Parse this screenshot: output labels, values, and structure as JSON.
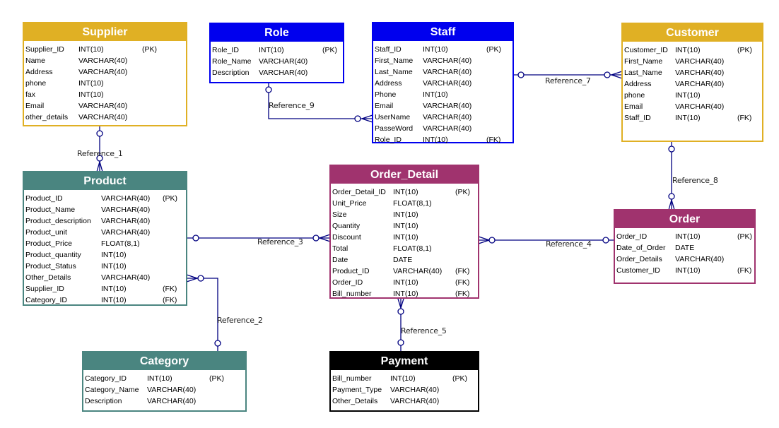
{
  "colors": {
    "gold": "#E0B024",
    "blue": "#0000EE",
    "teal": "#4A8580",
    "purple": "#A0336E",
    "black": "#000000",
    "line": "#000080"
  },
  "entities": {
    "supplier": {
      "title": "Supplier",
      "fields": [
        [
          "Supplier_ID",
          "INT(10)",
          "(PK)"
        ],
        [
          "Name",
          "VARCHAR(40)",
          ""
        ],
        [
          "Address",
          "VARCHAR(40)",
          ""
        ],
        [
          "phone",
          "INT(10)",
          ""
        ],
        [
          "fax",
          "INT(10)",
          ""
        ],
        [
          "Email",
          "VARCHAR(40)",
          ""
        ],
        [
          "other_details",
          "VARCHAR(40)",
          ""
        ]
      ]
    },
    "role": {
      "title": "Role",
      "fields": [
        [
          "Role_ID",
          "INT(10)",
          "(PK)"
        ],
        [
          "Role_Name",
          "VARCHAR(40)",
          ""
        ],
        [
          "Description",
          "VARCHAR(40)",
          ""
        ]
      ]
    },
    "staff": {
      "title": "Staff",
      "fields": [
        [
          "Staff_ID",
          "INT(10)",
          "(PK)"
        ],
        [
          "First_Name",
          "VARCHAR(40)",
          ""
        ],
        [
          "Last_Name",
          "VARCHAR(40)",
          ""
        ],
        [
          "Address",
          "VARCHAR(40)",
          ""
        ],
        [
          "Phone",
          "INT(10)",
          ""
        ],
        [
          "Email",
          "VARCHAR(40)",
          ""
        ],
        [
          "UserName",
          "VARCHAR(40)",
          ""
        ],
        [
          "PasseWord",
          "VARCHAR(40)",
          ""
        ],
        [
          "Role_ID",
          "INT(10)",
          "(FK)"
        ]
      ]
    },
    "customer": {
      "title": "Customer",
      "fields": [
        [
          "Customer_ID",
          "INT(10)",
          "(PK)"
        ],
        [
          "First_Name",
          "VARCHAR(40)",
          ""
        ],
        [
          "Last_Name",
          "VARCHAR(40)",
          ""
        ],
        [
          "Address",
          "VARCHAR(40)",
          ""
        ],
        [
          "phone",
          "INT(10)",
          ""
        ],
        [
          "Email",
          "VARCHAR(40)",
          ""
        ],
        [
          "Staff_ID",
          "INT(10)",
          "(FK)"
        ]
      ]
    },
    "product": {
      "title": "Product",
      "fields": [
        [
          "Product_ID",
          "VARCHAR(40)",
          "(PK)"
        ],
        [
          "Product_Name",
          "VARCHAR(40)",
          ""
        ],
        [
          "Product_description",
          "VARCHAR(40)",
          ""
        ],
        [
          "Product_unit",
          "VARCHAR(40)",
          ""
        ],
        [
          "Product_Price",
          "FLOAT(8,1)",
          ""
        ],
        [
          "Product_quantity",
          "INT(10)",
          ""
        ],
        [
          "Product_Status",
          "INT(10)",
          ""
        ],
        [
          "Other_Details",
          "VARCHAR(40)",
          ""
        ],
        [
          "Supplier_ID",
          "INT(10)",
          "(FK)"
        ],
        [
          "Category_ID",
          "INT(10)",
          "(FK)"
        ]
      ]
    },
    "order_detail": {
      "title": "Order_Detail",
      "fields": [
        [
          "Order_Detail_ID",
          "INT(10)",
          "(PK)"
        ],
        [
          "Unit_Price",
          "FLOAT(8,1)",
          ""
        ],
        [
          "Size",
          "INT(10)",
          ""
        ],
        [
          "Quantity",
          "INT(10)",
          ""
        ],
        [
          "Discount",
          "INT(10)",
          ""
        ],
        [
          "Total",
          "FLOAT(8,1)",
          ""
        ],
        [
          "Date",
          "DATE",
          ""
        ],
        [
          "Product_ID",
          "VARCHAR(40)",
          "(FK)"
        ],
        [
          "Order_ID",
          "INT(10)",
          "(FK)"
        ],
        [
          "Bill_number",
          "INT(10)",
          "(FK)"
        ]
      ]
    },
    "order": {
      "title": "Order",
      "fields": [
        [
          "Order_ID",
          "INT(10)",
          "(PK)"
        ],
        [
          "Date_of_Order",
          "DATE",
          ""
        ],
        [
          "Order_Details",
          "VARCHAR(40)",
          ""
        ],
        [
          "Customer_ID",
          "INT(10)",
          "(FK)"
        ]
      ]
    },
    "category": {
      "title": "Category",
      "fields": [
        [
          "Category_ID",
          "INT(10)",
          "(PK)"
        ],
        [
          "Category_Name",
          "VARCHAR(40)",
          ""
        ],
        [
          "Description",
          "VARCHAR(40)",
          ""
        ]
      ]
    },
    "payment": {
      "title": "Payment",
      "fields": [
        [
          "Bill_number",
          "INT(10)",
          "(PK)"
        ],
        [
          "Payment_Type",
          "VARCHAR(40)",
          ""
        ],
        [
          "Other_Details",
          "VARCHAR(40)",
          ""
        ]
      ]
    }
  },
  "references": {
    "r1": "Reference_1",
    "r2": "Reference_2",
    "r3": "Reference_3",
    "r4": "Reference_4",
    "r5": "Reference_5",
    "r7": "Reference_7",
    "r8": "Reference_8",
    "r9": "Reference_9"
  }
}
